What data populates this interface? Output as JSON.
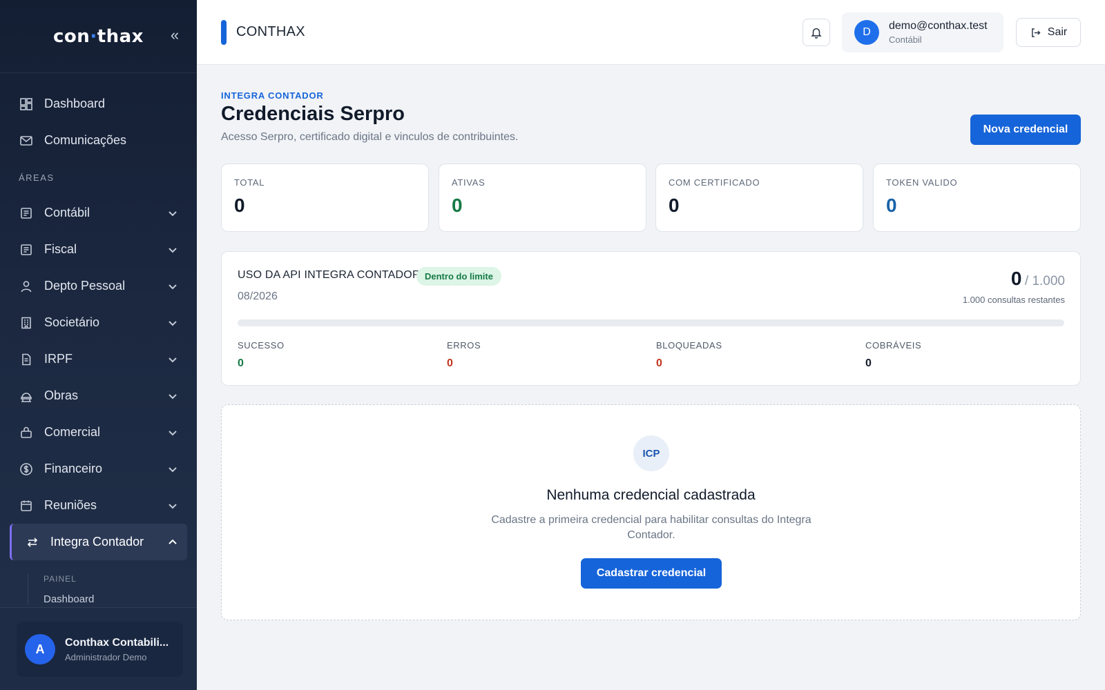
{
  "sidebar": {
    "logo_pre": "con",
    "logo_dot": "·",
    "logo_post": "thax",
    "collapse_icon": "double-chevron-left",
    "collapse_glyph": "«",
    "top_items": [
      {
        "label": "Dashboard",
        "icon": "dashboard-icon"
      },
      {
        "label": "Comunicações",
        "icon": "mail-icon"
      }
    ],
    "section_label": "ÁREAS",
    "areas": [
      {
        "label": "Contábil",
        "icon": "ledger-icon"
      },
      {
        "label": "Fiscal",
        "icon": "ledger-icon"
      },
      {
        "label": "Depto Pessoal",
        "icon": "user-icon"
      },
      {
        "label": "Societário",
        "icon": "building-icon"
      },
      {
        "label": "IRPF",
        "icon": "document-icon"
      },
      {
        "label": "Obras",
        "icon": "construction-icon"
      },
      {
        "label": "Comercial",
        "icon": "briefcase-icon"
      },
      {
        "label": "Financeiro",
        "icon": "dollar-icon"
      },
      {
        "label": "Reuniões",
        "icon": "calendar-icon"
      }
    ],
    "active_item": {
      "label": "Integra Contador",
      "icon": "swap-icon"
    },
    "sub_label": "PAINEL",
    "sub_item": "Dashboard",
    "user": {
      "initial": "A",
      "name": "Conthax Contabili...",
      "role": "Administrador Demo"
    }
  },
  "header": {
    "brand": "CONTHAX",
    "account": {
      "initial": "D",
      "email": "demo@conthax.test",
      "role": "Contábil"
    },
    "logout_label": "Sair"
  },
  "page": {
    "eyebrow": "INTEGRA CONTADOR",
    "title": "Credenciais Serpro",
    "subtitle": "Acesso Serpro, certificado digital e vinculos de contribuintes.",
    "new_button": "Nova credencial"
  },
  "stats": [
    {
      "label": "TOTAL",
      "value": "0",
      "color": "#111a2a"
    },
    {
      "label": "ATIVAS",
      "value": "0",
      "color": "#167a45"
    },
    {
      "label": "COM CERTIFICADO",
      "value": "0",
      "color": "#111a2a"
    },
    {
      "label": "TOKEN VALIDO",
      "value": "0",
      "color": "#1a63a8"
    }
  ],
  "usage": {
    "title": "USO DA API INTEGRA CONTADOR",
    "badge": "Dentro do limite",
    "period": "08/2026",
    "used": "0",
    "limit": "/ 1.000",
    "remaining": "1.000 consultas restantes",
    "progress_fraction": 0,
    "metrics": [
      {
        "label": "SUCESSO",
        "value": "0",
        "color": "#167a45"
      },
      {
        "label": "ERROS",
        "value": "0",
        "color": "#c0341d"
      },
      {
        "label": "BLOQUEADAS",
        "value": "0",
        "color": "#c0341d"
      },
      {
        "label": "COBRÁVEIS",
        "value": "0",
        "color": "#111a2a"
      }
    ]
  },
  "empty_state": {
    "badge": "ICP",
    "title": "Nenhuma credencial cadastrada",
    "description": "Cadastre a primeira credencial para habilitar consultas do Integra Contador.",
    "button": "Cadastrar credencial"
  }
}
